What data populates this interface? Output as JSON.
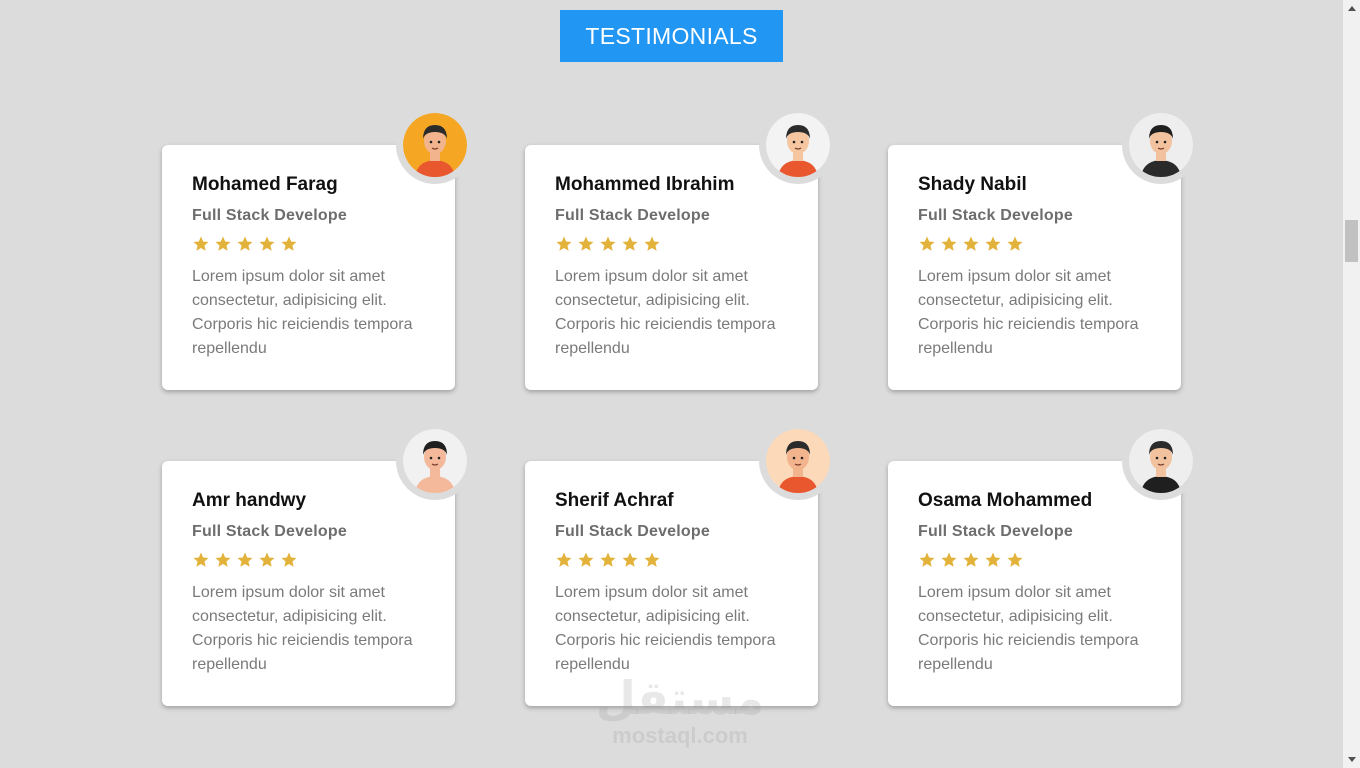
{
  "section": {
    "title": "TESTIMONIALS"
  },
  "colors": {
    "accent": "#2196f3",
    "star": "#e2b23a",
    "background": "#dcdcdc"
  },
  "testimonials": [
    {
      "name": "Mohamed Farag",
      "role": "Full Stack Develope",
      "rating": 5,
      "quote": "Lorem ipsum dolor sit amet consectetur, adipisicing elit. Corporis hic reiciendis tempora repellendu",
      "avatar": {
        "icon": "avatar-orange-shirt-icon",
        "bg": "#f5a623",
        "skin": "#f2b48c",
        "hair": "#2b2b2b",
        "shirt": "#e8572e"
      }
    },
    {
      "name": "Mohammed Ibrahim",
      "role": "Full Stack Develope",
      "rating": 5,
      "quote": "Lorem ipsum dolor sit amet consectetur, adipisicing elit. Corporis hic reiciendis tempora repellendu",
      "avatar": {
        "icon": "avatar-bearded-man-icon",
        "bg": "#f3f3f3",
        "skin": "#f5c6a0",
        "hair": "#2b2b2b",
        "shirt": "#e8572e"
      }
    },
    {
      "name": "Shady Nabil",
      "role": "Full Stack Develope",
      "rating": 5,
      "quote": "Lorem ipsum dolor sit amet consectetur, adipisicing elit. Corporis hic reiciendis tempora repellendu",
      "avatar": {
        "icon": "avatar-glasses-man-icon",
        "bg": "#eeeeee",
        "skin": "#f2c29e",
        "hair": "#1f1f1f",
        "shirt": "#2a2a2a"
      }
    },
    {
      "name": "Amr handwy",
      "role": "Full Stack Develope",
      "rating": 5,
      "quote": "Lorem ipsum dolor sit amet consectetur, adipisicing elit. Corporis hic reiciendis tempora repellendu",
      "avatar": {
        "icon": "avatar-mustache-man-icon",
        "bg": "#f1f1f1",
        "skin": "#f4b99a",
        "hair": "#1f1f1f",
        "shirt": "#f4b99a"
      }
    },
    {
      "name": "Sherif Achraf",
      "role": "Full Stack Develope",
      "rating": 5,
      "quote": "Lorem ipsum dolor sit amet consectetur, adipisicing elit. Corporis hic reiciendis tempora repellendu",
      "avatar": {
        "icon": "avatar-peach-bg-man-icon",
        "bg": "#fcd9b8",
        "skin": "#f2b48c",
        "hair": "#2b2b2b",
        "shirt": "#e8572e"
      }
    },
    {
      "name": "Osama Mohammed",
      "role": "Full Stack Develope",
      "rating": 5,
      "quote": "Lorem ipsum dolor sit amet consectetur, adipisicing elit. Corporis hic reiciendis tempora repellendu",
      "avatar": {
        "icon": "avatar-mohawk-man-icon",
        "bg": "#eeeeee",
        "skin": "#f2c29e",
        "hair": "#2b2b2b",
        "shirt": "#1f1f1f"
      }
    }
  ],
  "watermark": {
    "logo": "مستقل",
    "url": "mostaql.com"
  }
}
